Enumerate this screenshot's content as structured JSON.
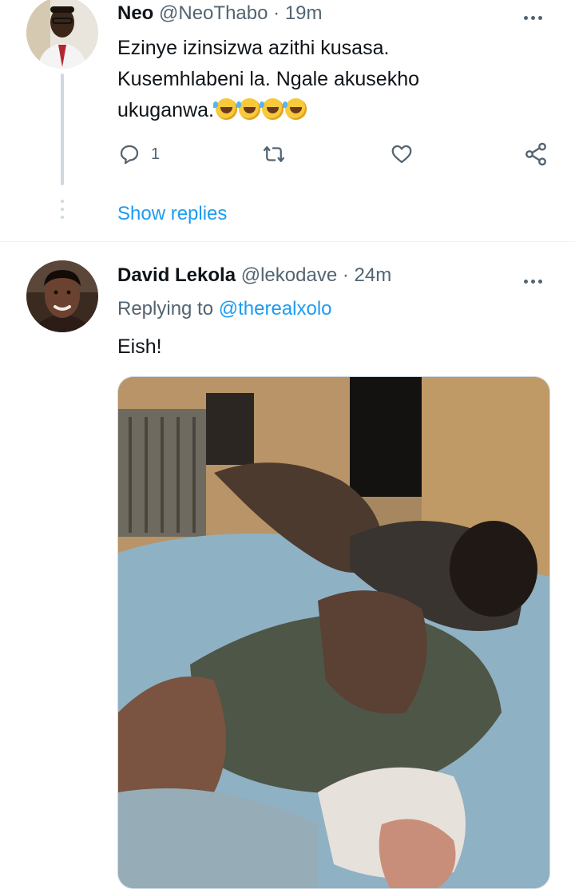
{
  "tweets": [
    {
      "name": "Neo",
      "handle": "@NeoThabo",
      "separator": "·",
      "time": "19m",
      "text_lines": [
        "Ezinye izinsizwa azithi kusasa.",
        "Kusemhlabeni la. Ngale akusekho",
        "ukuganwa."
      ],
      "emoji": [
        "rolling-on-floor-laughing",
        "rolling-on-floor-laughing",
        "rolling-on-floor-laughing",
        "rolling-on-floor-laughing"
      ],
      "reply_count": "1",
      "show_replies": "Show replies"
    },
    {
      "name": "David Lekola",
      "handle": "@lekodave",
      "separator": "·",
      "time": "24m",
      "replying_label": "Replying to",
      "replying_handle": "@therealxolo",
      "text": "Eish!"
    }
  ],
  "icons": {
    "more": "more-icon",
    "reply": "reply-icon",
    "retweet": "retweet-icon",
    "like": "like-icon",
    "share": "share-icon"
  },
  "colors": {
    "accent": "#1d9bf0",
    "secondary_text": "#536471",
    "primary_text": "#0f1419",
    "thread_line": "#cfd9de"
  }
}
